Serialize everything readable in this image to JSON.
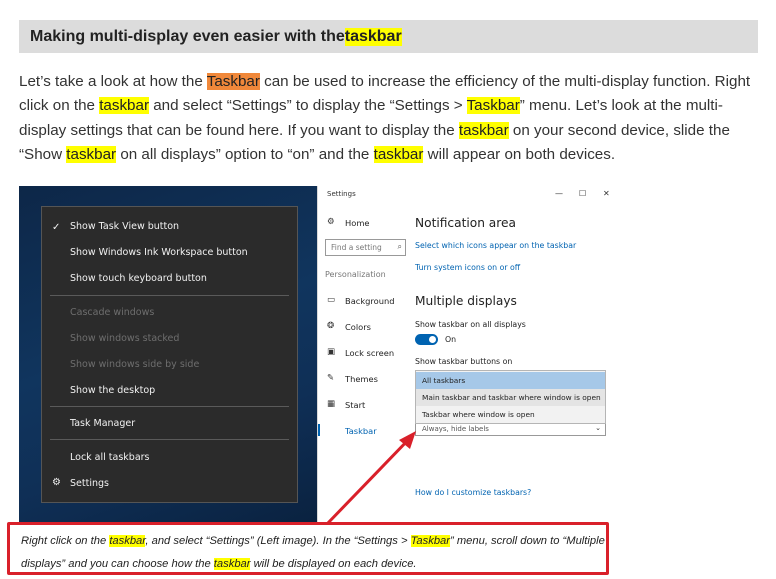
{
  "heading": {
    "pre": "Making multi-display even easier with the ",
    "hl": "taskbar"
  },
  "intro": {
    "p1": "Let’s take a look at how the ",
    "h1": "Taskbar",
    "p2": " can be used to increase the efficiency of the multi-display function. Right click on the ",
    "h2": "taskbar",
    "p3": " and select “Settings” to display the “Settings > ",
    "h3": "Taskbar",
    "p4": "” menu. Let’s look at the multi-display settings that can be found here. If you want to display the ",
    "h4": "taskbar",
    "p5": " on your second device, slide the “Show ",
    "h5": "taskbar",
    "p6": " on all displays” option to “on” and the ",
    "h6": "taskbar",
    "p7": " will appear on both devices."
  },
  "context_menu": {
    "check_glyph": "✓",
    "gear_glyph": "⚙",
    "items": [
      "Show Task View button",
      "Show Windows Ink Workspace button",
      "Show touch keyboard button",
      "Cascade windows",
      "Show windows stacked",
      "Show windows side by side",
      "Show the desktop",
      "Task Manager",
      "Lock all taskbars",
      "Settings"
    ]
  },
  "settings_window": {
    "title": "Settings",
    "controls": {
      "minimize": "—",
      "maximize": "☐",
      "close": "✕"
    },
    "sidebar": {
      "home": "Home",
      "find_placeholder": "Find a setting",
      "group": "Personalization",
      "items": [
        "Background",
        "Colors",
        "Lock screen",
        "Themes",
        "Start",
        "Taskbar"
      ]
    },
    "content": {
      "notification_heading": "Notification area",
      "link1": "Select which icons appear on the taskbar",
      "link2": "Turn system icons on or off",
      "multiple_heading": "Multiple displays",
      "show_all_label": "Show taskbar on all displays",
      "toggle_state": "On",
      "buttons_label": "Show taskbar buttons on",
      "dropdown_options": [
        "All taskbars",
        "Main taskbar and taskbar where window is open",
        "Taskbar where window is open"
      ],
      "combine_value": "Always, hide labels",
      "help_link": "How do I customize taskbars?"
    }
  },
  "caption": {
    "c1": "Right click on the ",
    "h1": "taskbar",
    "c2": ", and select “Settings” (Left image). In the “Settings > ",
    "h2": "Taskbar",
    "c3": "” menu, scroll down to “Multiple displays” and you can choose how the ",
    "h3": "taskbar",
    "c4": " will be displayed on each device."
  },
  "colors": {
    "highlight": "#ffff00",
    "highlight_alt": "#f0883a",
    "annotation": "#d9202a",
    "accent": "#0063b1"
  }
}
